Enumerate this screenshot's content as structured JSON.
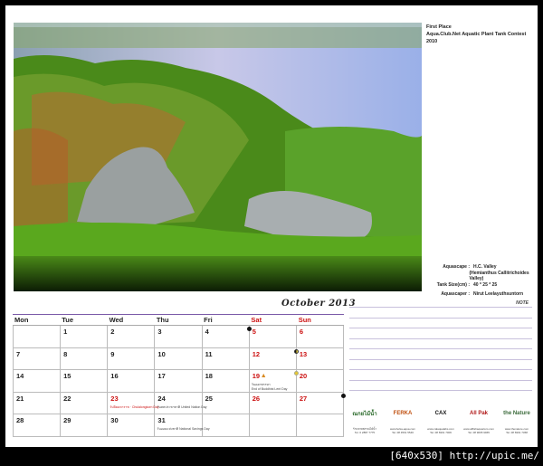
{
  "info_top": {
    "place": "First Place",
    "contest": "Aqua.Club.Net Aquatic Plant Tank Contest 2010"
  },
  "info_bottom": [
    {
      "label": "Aquascape :",
      "value": "H.C. Valley"
    },
    {
      "label": "",
      "value": "(Hemianthus Callitrichoides Valley)"
    },
    {
      "label": "Tank Size(cm) :",
      "value": "40 * 25 * 25"
    },
    {
      "label": "Aquascaper :",
      "value": "Nirut Leelayuthsuntorn"
    }
  ],
  "calendar": {
    "month_title": "October 2013",
    "days": [
      "Mon",
      "Tue",
      "Wed",
      "Thu",
      "Fri",
      "Sat",
      "Sun"
    ],
    "cells": [
      {
        "n": ""
      },
      {
        "n": "1"
      },
      {
        "n": "2"
      },
      {
        "n": "3"
      },
      {
        "n": "4",
        "moon": "new"
      },
      {
        "n": "5",
        "red": true
      },
      {
        "n": "6",
        "red": true
      },
      {
        "n": "7"
      },
      {
        "n": "8"
      },
      {
        "n": "9"
      },
      {
        "n": "10"
      },
      {
        "n": "11"
      },
      {
        "n": "12",
        "red": true,
        "moon": "half"
      },
      {
        "n": "13",
        "red": true
      },
      {
        "n": "14"
      },
      {
        "n": "15"
      },
      {
        "n": "16"
      },
      {
        "n": "17"
      },
      {
        "n": "18"
      },
      {
        "n": "19",
        "red": true,
        "buddha": true,
        "moon": "full",
        "note": "วันออกพรรษา\nEnd of Buddhist Lent Day"
      },
      {
        "n": "20",
        "red": true
      },
      {
        "n": "21"
      },
      {
        "n": "22"
      },
      {
        "n": "23",
        "red": true,
        "note": "วันปิยมหาราช · Chulalongkorn Day",
        "note_red": true
      },
      {
        "n": "24",
        "note": "วันสหประชาชาติ United Nation Day"
      },
      {
        "n": "25"
      },
      {
        "n": "26",
        "red": true
      },
      {
        "n": "27",
        "red": true,
        "moon": "new"
      },
      {
        "n": "28"
      },
      {
        "n": "29"
      },
      {
        "n": "30"
      },
      {
        "n": "31",
        "note": "วันออมแห่งชาติ National Savings Day"
      },
      {
        "n": ""
      },
      {
        "n": ""
      },
      {
        "n": ""
      }
    ]
  },
  "notes_title": "NOTE",
  "sponsors": [
    {
      "logo": "ณกยไม้น้ำ",
      "color": "#2a6a2a",
      "text": "ร้านขายพรรณไม้น้ำ\nTel. 0 2887 7775"
    },
    {
      "logo": "FERKA",
      "color": "#c05010",
      "text": "www.ferka-aqua.com\nTel. 08 4561 5546"
    },
    {
      "logo": "CAX",
      "color": "#111111",
      "text": "www.calaqualabs.com\nTel. 08 6961 7006"
    },
    {
      "logo": "All Pak",
      "color": "#b01818",
      "text": "www.allfishaquarium.com\nTel. 08 9065 9965"
    },
    {
      "logo": "the Nature",
      "color": "#3a6a3a",
      "text": "www.thenature.com\nTel. 08 6991 7368"
    }
  ],
  "watermark": "[640x530] http://upic.me/",
  "colors": {
    "accent": "#7a5aa8",
    "holiday": "#cc1111"
  }
}
